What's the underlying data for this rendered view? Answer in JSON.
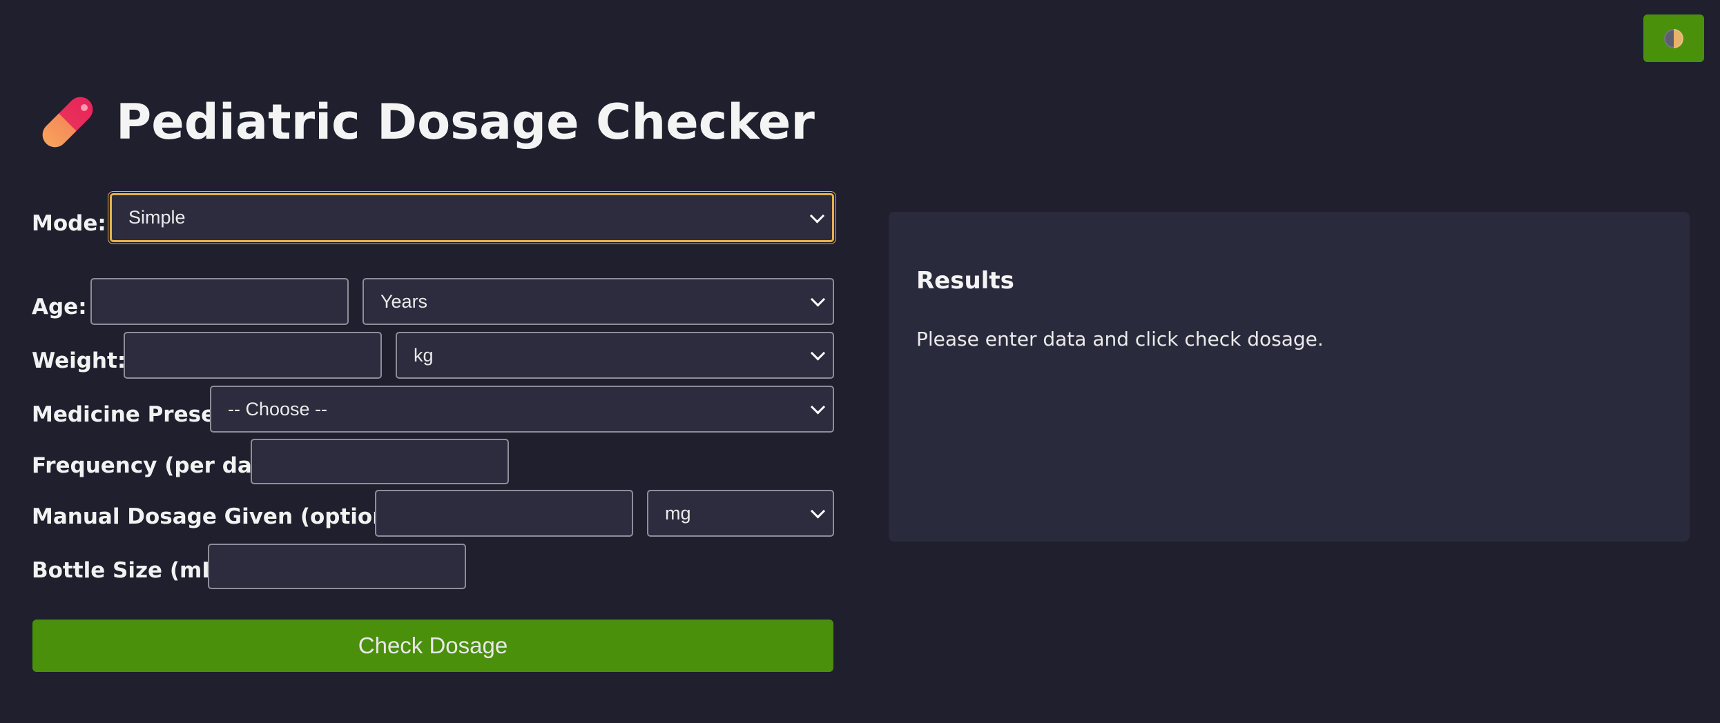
{
  "theme_toggle": {
    "icon": "half-moon-icon"
  },
  "header": {
    "icon": "pill-icon",
    "title": "Pediatric Dosage Checker"
  },
  "form": {
    "mode": {
      "label": "Mode:",
      "value": "Simple"
    },
    "age": {
      "label": "Age:",
      "value": "",
      "unit": "Years"
    },
    "weight": {
      "label": "Weight:",
      "value": "",
      "unit": "kg"
    },
    "medicine_preset": {
      "label": "Medicine Preset:",
      "value": "-- Choose --"
    },
    "frequency": {
      "label": "Frequency (per day):",
      "value": ""
    },
    "manual_dosage": {
      "label": "Manual Dosage Given (optional):",
      "value": "",
      "unit": "mg"
    },
    "bottle_size": {
      "label": "Bottle Size (mL):",
      "value": ""
    },
    "submit_label": "Check Dosage"
  },
  "results": {
    "title": "Results",
    "message": "Please enter data and click check dosage."
  },
  "colors": {
    "background": "#1f1f2e",
    "panel": "#2a2a3d",
    "accent_green": "#4a900b",
    "focus_ring": "#e5b24d"
  }
}
